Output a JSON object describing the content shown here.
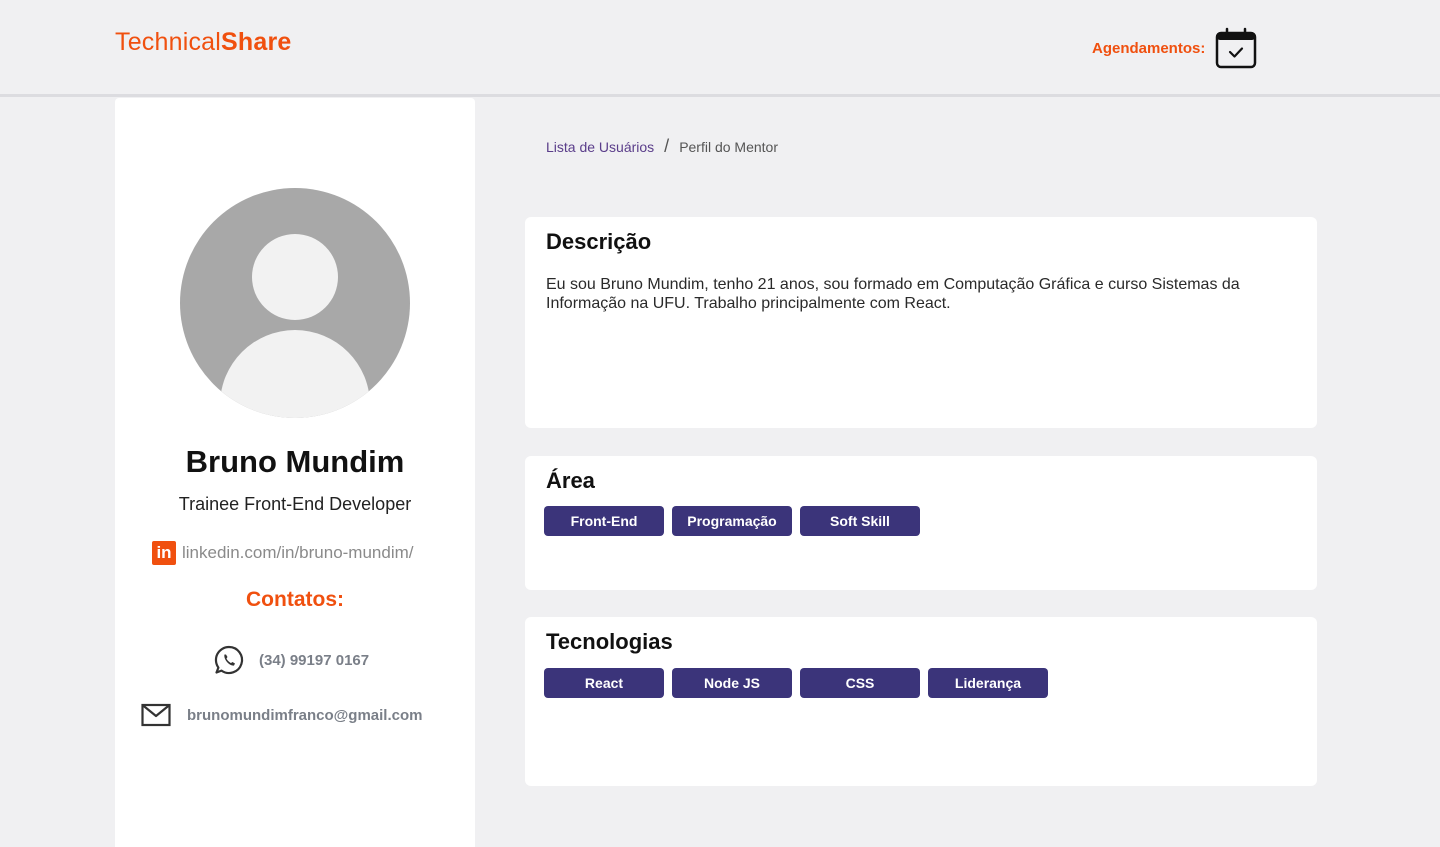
{
  "header": {
    "logo_light": "Technical",
    "logo_bold": "Share",
    "schedule_label": "Agendamentos:",
    "schedule_icon": "calendar-check-icon"
  },
  "profile": {
    "name": "Bruno Mundim",
    "role": "Trainee Front-End Developer",
    "linkedin_icon_text": "in",
    "linkedin": "linkedin.com/in/bruno-mundim/",
    "contacts_title": "Contatos:",
    "phone": "(34) 99197 0167",
    "email": "brunomundimfranco@gmail.com"
  },
  "breadcrumb": {
    "items": [
      "Lista de Usuários",
      "Perfil do Mentor"
    ],
    "separator": "/"
  },
  "description": {
    "title": "Descrição",
    "text": "Eu sou Bruno Mundim, tenho 21 anos, sou formado em Computação Gráfica e curso Sistemas da Informação na UFU. Trabalho principalmente com React."
  },
  "area": {
    "title": "Área",
    "tags": [
      "Front-End",
      "Programação",
      "Soft Skill"
    ]
  },
  "technologies": {
    "title": "Tecnologias",
    "tags": [
      "React",
      "Node JS",
      "CSS",
      "Liderança"
    ]
  },
  "colors": {
    "accent": "#f0500f",
    "tag_bg": "#3b347a",
    "page_bg": "#f0f0f2"
  }
}
